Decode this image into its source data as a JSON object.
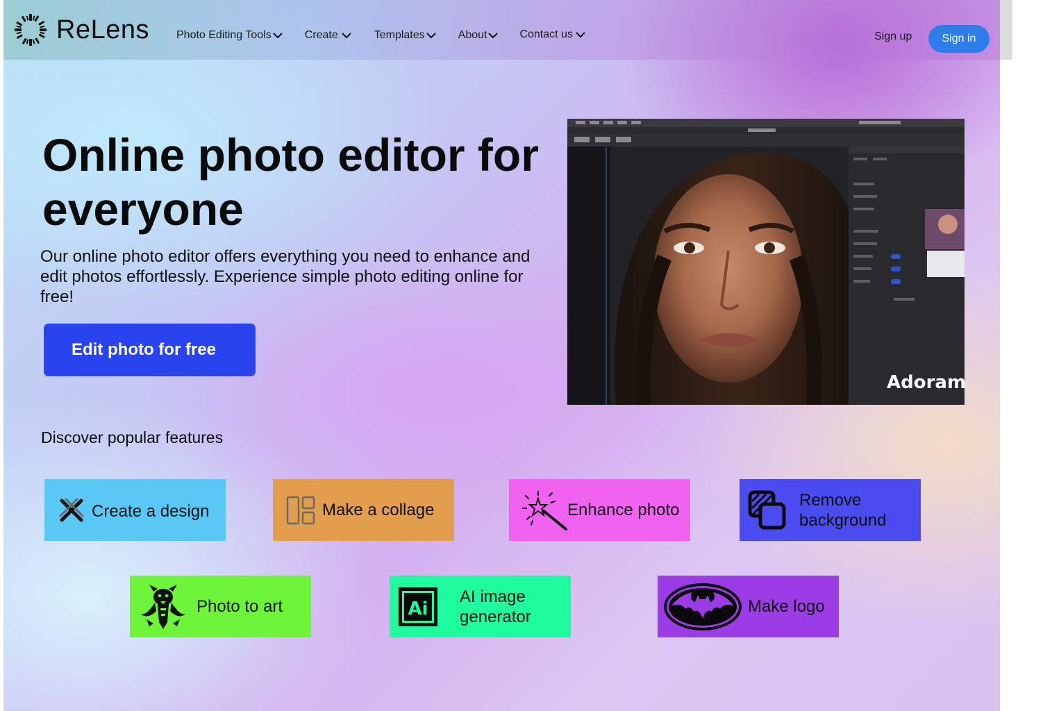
{
  "brand": {
    "name": "ReLens"
  },
  "nav": {
    "items": [
      {
        "label": "Photo Editing Tools"
      },
      {
        "label": "Create"
      },
      {
        "label": "Templates"
      },
      {
        "label": "About"
      },
      {
        "label": "Contact us"
      }
    ],
    "signup": "Sign up",
    "signin": "Sign in"
  },
  "hero": {
    "title": "Online photo editor for everyone",
    "subtitle": "Our online photo editor offers everything you need to enhance and edit photos effortlessly. Experience simple photo editing online for free!",
    "cta": "Edit photo for free",
    "image_watermark": "Adoram"
  },
  "features": {
    "heading": "Discover popular features",
    "items": [
      {
        "label": "Create a design",
        "icon": "cross-tools-icon",
        "color": "#5ac8f5"
      },
      {
        "label": "Make a collage",
        "icon": "collage-layout-icon",
        "color": "#e29d4d"
      },
      {
        "label": "Enhance photo",
        "icon": "magic-wand-icon",
        "color": "#f062f0"
      },
      {
        "label": "Remove background",
        "icon": "layers-icon",
        "color": "#4a4cf0"
      },
      {
        "label": "Photo to art",
        "icon": "panther-icon",
        "color": "#6ef53a"
      },
      {
        "label": "AI image generator",
        "icon": "ai-logo-icon",
        "color": "#1ffc9e"
      },
      {
        "label": "Make logo",
        "icon": "bat-logo-icon",
        "color": "#9b3ce6"
      }
    ]
  }
}
